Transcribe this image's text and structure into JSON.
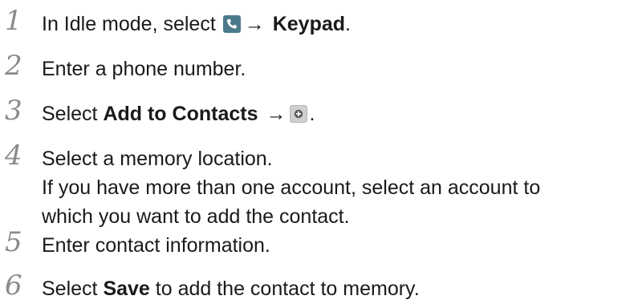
{
  "steps": [
    {
      "number": "1",
      "prefix": "In Idle mode, select",
      "icon": "phone-icon",
      "arrow": "→",
      "bold": "Keypad",
      "suffix": "."
    },
    {
      "number": "2",
      "text": "Enter a phone number."
    },
    {
      "number": "3",
      "prefix": "Select",
      "bold": "Add to Contacts",
      "arrow": "→",
      "icon": "add-icon",
      "suffix": "."
    },
    {
      "number": "4",
      "text": "Select a memory location.",
      "note_line1": "If you have more than one account, select an account to",
      "note_line2": "which you want to add the contact."
    },
    {
      "number": "5",
      "text": "Enter contact information."
    },
    {
      "number": "6",
      "prefix": "Select",
      "bold": "Save",
      "suffix": "to add the contact to memory."
    }
  ],
  "colors": {
    "step_number": "#8a8a8a",
    "text": "#1a1a1a",
    "phone_icon_bg": "#4a7a8c",
    "add_icon_bg": "#d0d0d0"
  }
}
